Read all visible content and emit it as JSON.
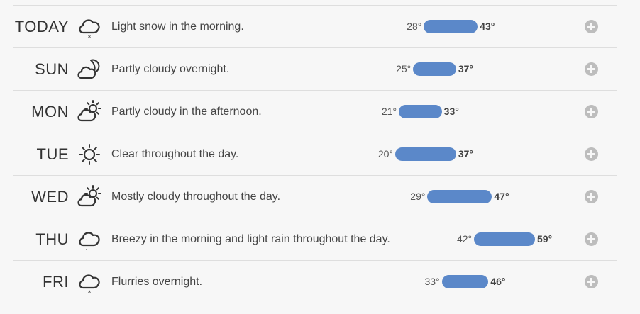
{
  "colors": {
    "bar": "#5b88c9",
    "expand_button": "#bdbdbd",
    "icon_stroke": "#333333"
  },
  "scale": {
    "min_temp": 20,
    "max_temp": 59
  },
  "days": [
    {
      "day": "TODAY",
      "icon": "snow-cloud-icon",
      "summary": "Light snow in the morning.",
      "low": 28,
      "high": 43,
      "low_label": "28°",
      "high_label": "43°"
    },
    {
      "day": "SUN",
      "icon": "partly-cloudy-night-icon",
      "summary": "Partly cloudy overnight.",
      "low": 25,
      "high": 37,
      "low_label": "25°",
      "high_label": "37°"
    },
    {
      "day": "MON",
      "icon": "partly-cloudy-day-icon",
      "summary": "Partly cloudy in the afternoon.",
      "low": 21,
      "high": 33,
      "low_label": "21°",
      "high_label": "33°"
    },
    {
      "day": "TUE",
      "icon": "clear-day-icon",
      "summary": "Clear throughout the day.",
      "low": 20,
      "high": 37,
      "low_label": "20°",
      "high_label": "37°"
    },
    {
      "day": "WED",
      "icon": "partly-cloudy-day-icon",
      "summary": "Mostly cloudy throughout the day.",
      "low": 29,
      "high": 47,
      "low_label": "29°",
      "high_label": "47°"
    },
    {
      "day": "THU",
      "icon": "rain-cloud-icon",
      "summary": "Breezy in the morning and light rain throughout the day.",
      "low": 42,
      "high": 59,
      "low_label": "42°",
      "high_label": "59°"
    },
    {
      "day": "FRI",
      "icon": "snow-cloud-icon",
      "summary": "Flurries overnight.",
      "low": 33,
      "high": 46,
      "low_label": "33°",
      "high_label": "46°"
    }
  ]
}
